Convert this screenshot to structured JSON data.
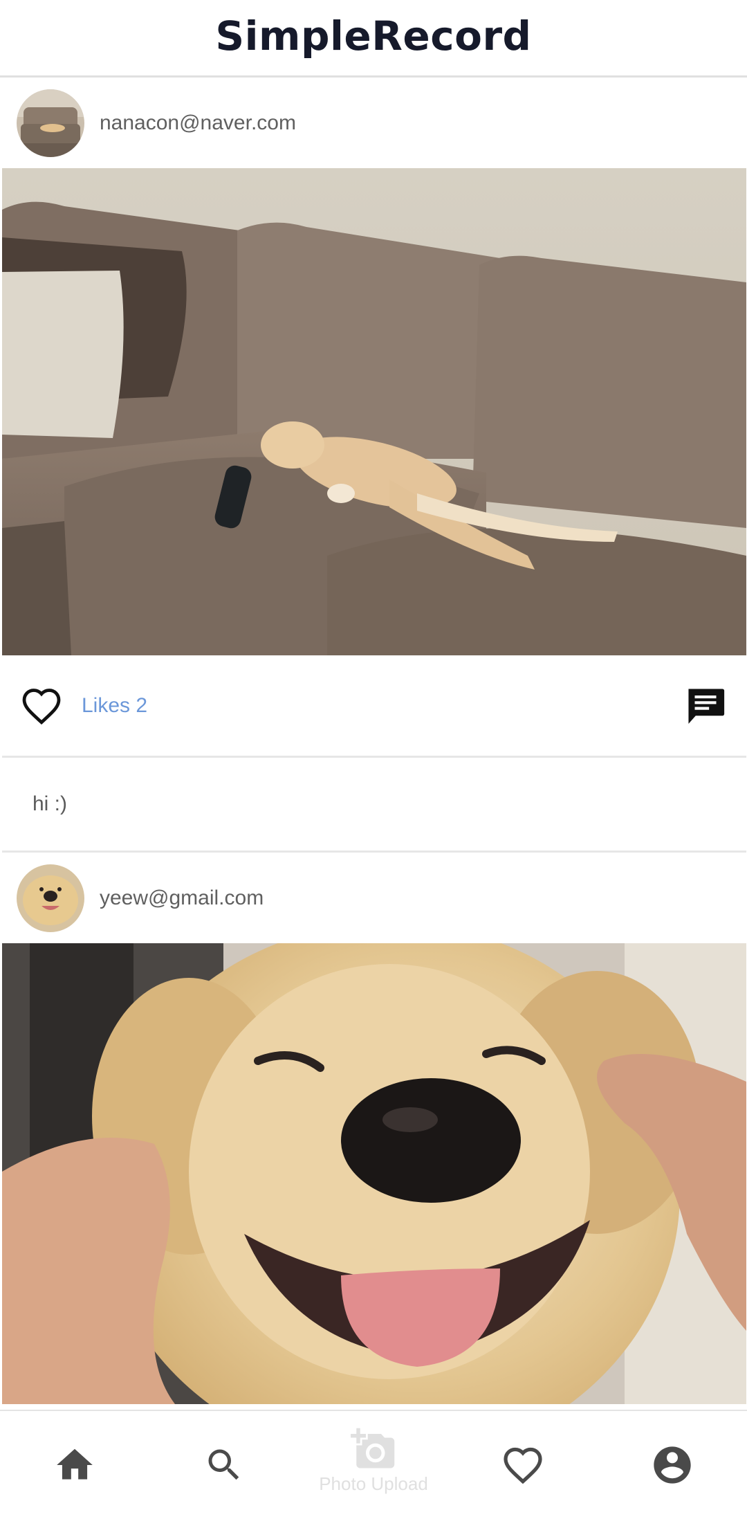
{
  "app": {
    "title": "SimpleRecord"
  },
  "posts": [
    {
      "author": "nanacon@naver.com",
      "likes_label": "Likes 2",
      "caption": "hi :)"
    },
    {
      "author": "yeew@gmail.com"
    }
  ],
  "nav": {
    "items": [
      {
        "icon": "home-icon"
      },
      {
        "icon": "search-icon"
      },
      {
        "icon": "add-photo-icon",
        "label": "Photo Upload"
      },
      {
        "icon": "heart-icon"
      },
      {
        "icon": "account-icon"
      }
    ]
  },
  "colors": {
    "likes_text": "#6b97d9",
    "title": "#161a2b",
    "nav_icon": "#4a4a4a",
    "upload_disabled": "#e0e0e0"
  }
}
